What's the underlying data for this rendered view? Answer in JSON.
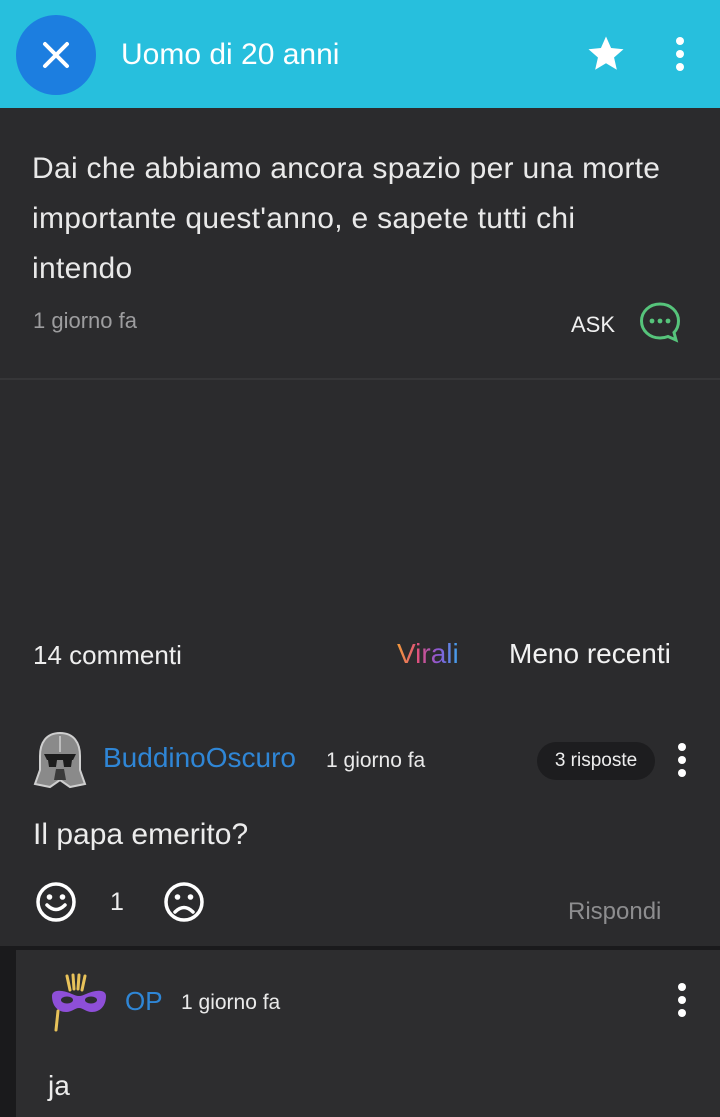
{
  "header": {
    "title": "Uomo di 20 anni",
    "close_icon": "close-icon",
    "favorite_icon": "star-icon",
    "menu_icon": "more-vertical-icon",
    "bg_color": "#27bfdd",
    "close_bg_color": "#1c7ee0"
  },
  "post": {
    "text": "Dai che abbiamo ancora spazio per una morte importante quest'anno, e sapete tutti chi intendo",
    "time": "1 giorno fa",
    "ask_label": "ASK",
    "ask_icon": "chat-bubble-icon",
    "accent_color": "#56c47b"
  },
  "comments_bar": {
    "count_label": "14 commenti",
    "tab_virali": "Virali",
    "tab_recenti": "Meno recenti"
  },
  "comment": {
    "username": "BuddinoOscuro",
    "time": "1 giorno fa",
    "replies_label": "3 risposte",
    "text": "Il papa emerito?",
    "vote_count": "1",
    "reply_label": "Rispondi",
    "avatar_icon": "darth-vader-avatar-icon",
    "username_color": "#2f86d6"
  },
  "reply": {
    "username": "OP",
    "time": "1 giorno fa",
    "text": "ja",
    "avatar_icon": "carnival-mask-avatar-icon"
  }
}
